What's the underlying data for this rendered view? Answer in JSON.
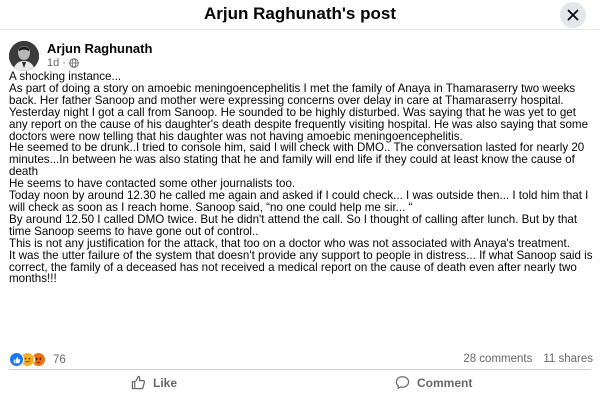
{
  "header": {
    "title": "Arjun Raghunath's post"
  },
  "icons": {
    "close": "close-icon",
    "globe": "globe-icon",
    "like": "thumbs-up-icon",
    "comment": "comment-icon"
  },
  "post": {
    "author": "Arjun Raghunath",
    "time": "1d",
    "separator": "·",
    "lines": [
      "A shocking instance...",
      "As part of doing a story on amoebic meningoencephelitis I met the family of Anaya in Thamaraserry two weeks back. Her father Sanoop and mother were expressing concerns over delay in care at Thamaraserry hospital.",
      "Yesterday night I got a call from Sanoop. He sounded to be highly disturbed. Was saying that he was yet to get any report on the cause of his daughter's death despite frequently visiting hospital. He was also saying that some doctors were now telling that his daughter was not having amoebic meningoencephelitis.",
      "He seemed to be drunk..I tried to console him, said I will check with DMO.. The conversation lasted for nearly 20 minutes...In between he was also stating that he and family will end life if they could at least know the cause of death",
      "He seems to have contacted some other journalists too.",
      "Today noon by around 12.30 he called me again and asked if I could check... I was outside then... I told him that I  will check as soon as I reach home. Sanoop said, “no one could help me sir... “",
      "By around 12.50 I called DMO twice. But he didn't attend the call. So  I thought of calling after lunch. But by that time Sanoop seems to have gone out of control..",
      "This is not any justification for the attack, that too on a doctor who was not associated with Anaya's treatment.",
      "It was the utter failure of the system that doesn't provide any support to people in distress... If what Sanoop said is correct, the family of a deceased has not received a medical report on the cause of death even after nearly two months!!!"
    ]
  },
  "stats": {
    "reaction_count": "76",
    "reaction_types": [
      "like",
      "sad",
      "angry"
    ],
    "comments": "28 comments",
    "shares": "11 shares"
  },
  "actions": {
    "like": "Like",
    "comment": "Comment"
  },
  "colors": {
    "like_blue": "#1877f2",
    "sad_yellow": "#f7b125",
    "angry_orange": "#e9710f",
    "secondary_text": "#65676b"
  }
}
